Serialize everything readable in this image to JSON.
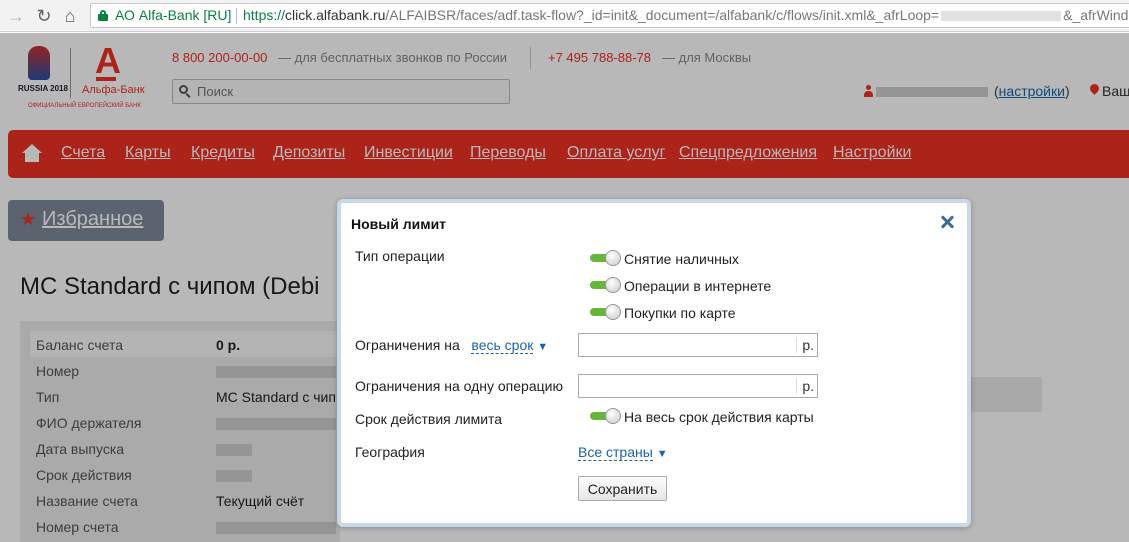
{
  "browser": {
    "cert_name": "АО Alfa-Bank [RU]",
    "url_scheme": "https://",
    "url_host": "click.alfabank.ru",
    "url_path": "/ALFAIBSR/faces/adf.task-flow?_id=init&_document=/alfabank/c/flows/init.xml&_afrLoop=",
    "url_tail": "&_afrWind"
  },
  "header": {
    "logo_worldcup": "RUSSIA 2018",
    "logo_bank": "Альфа-Банк",
    "logo_official": "ОФИЦИАЛЬНЫЙ ЕВРОПЕЙСКИЙ БАНК",
    "phone_free": "8 800 200-00-00",
    "phone_free_note": "— для бесплатных звонков по России",
    "phone_moscow": "+7 495 788-88-78",
    "phone_moscow_note": "— для Москвы",
    "search_placeholder": "Поиск",
    "settings_link": "настройки",
    "geo": "Ваш"
  },
  "menu": {
    "items": [
      "Счета",
      "Карты",
      "Кредиты",
      "Депозиты",
      "Инвестиции",
      "Переводы",
      "Оплата услуг",
      "Спецпредложения",
      "Настройки"
    ]
  },
  "favorites_label": "Избранное",
  "product": {
    "title": "MC Standard с чипом (Debi",
    "rows": [
      {
        "label": "Баланс счета",
        "value": "0 р."
      },
      {
        "label": "Номер",
        "value": ""
      },
      {
        "label": "Тип",
        "value": "MC Standard с чип"
      },
      {
        "label": "ФИО держателя",
        "value": ""
      },
      {
        "label": "Дата выпуска",
        "value": ""
      },
      {
        "label": "Срок действия",
        "value": ""
      },
      {
        "label": "Название счета",
        "value": "Текущий счёт"
      },
      {
        "label": "Номер счета",
        "value": ""
      }
    ]
  },
  "modal": {
    "title": "Новый лимит",
    "op_type_label": "Тип операции",
    "op_types": [
      "Снятие наличных",
      "Операции в интернете",
      "Покупки по карте"
    ],
    "limit_period_label": "Ограничения на",
    "limit_period_value": "весь срок",
    "limit_period_amount": "",
    "per_op_label": "Ограничения на одну операцию",
    "per_op_amount": "",
    "currency_unit": "р.",
    "validity_label": "Срок действия лимита",
    "validity_value": "На весь срок действия карты",
    "geo_label": "География",
    "geo_value": "Все страны",
    "save_label": "Сохранить"
  },
  "colors": {
    "brand_red": "#ef3124",
    "toggle_on": "#66b63c",
    "link_blue": "#1a64ab"
  }
}
